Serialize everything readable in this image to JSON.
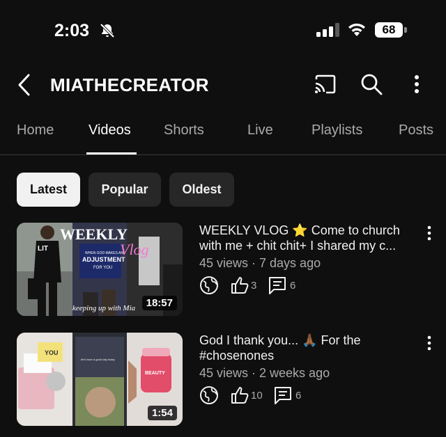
{
  "status_bar": {
    "time": "2:03",
    "battery": "68",
    "icons": [
      "bell-slash-icon",
      "signal-icon",
      "wifi-icon",
      "battery-icon"
    ]
  },
  "header": {
    "channel_name": "MIATHECREATOR",
    "icons": [
      "back-icon",
      "cast-icon",
      "search-icon",
      "more-vert-icon"
    ]
  },
  "tabs": [
    {
      "label": "Home",
      "active": false
    },
    {
      "label": "Videos",
      "active": true
    },
    {
      "label": "Shorts",
      "active": false
    },
    {
      "label": "Live",
      "active": false
    },
    {
      "label": "Playlists",
      "active": false
    },
    {
      "label": "Posts",
      "active": false
    }
  ],
  "filter_chips": [
    {
      "label": "Latest",
      "selected": true
    },
    {
      "label": "Popular",
      "selected": false
    },
    {
      "label": "Oldest",
      "selected": false
    }
  ],
  "videos": [
    {
      "title": "WEEKLY VLOG ⭐ Come to church with me + chit chit+ I shared my c...",
      "meta": "45 views · 7 days ago",
      "likes": "3",
      "comments": "6",
      "duration": "18:57",
      "thumb_text": {
        "weekly": "WEEKLY",
        "vlog": "Vlog",
        "screen_line1": "WHEN GOD MAKES AN",
        "screen_line2": "ADJUSTMENT",
        "screen_line3": "FOR YOU",
        "caption": "keeping up with Mia",
        "shirt": "LIT"
      }
    },
    {
      "title": "God I thank you... 🙏🏾 For the #chosenones",
      "meta": "45 views · 2 weeks ago",
      "likes": "10",
      "comments": "6",
      "duration": "1:54",
      "thumb_text": {
        "sticky": "YOU",
        "bottle": "BEAUTY",
        "screen": "let's have a good day today"
      }
    }
  ],
  "colors": {
    "background": "#0f0f0f",
    "text_primary": "#f1f1f1",
    "text_secondary": "#aaaaaa",
    "chip_bg": "#272727",
    "chip_selected_bg": "#f1f1f1"
  }
}
